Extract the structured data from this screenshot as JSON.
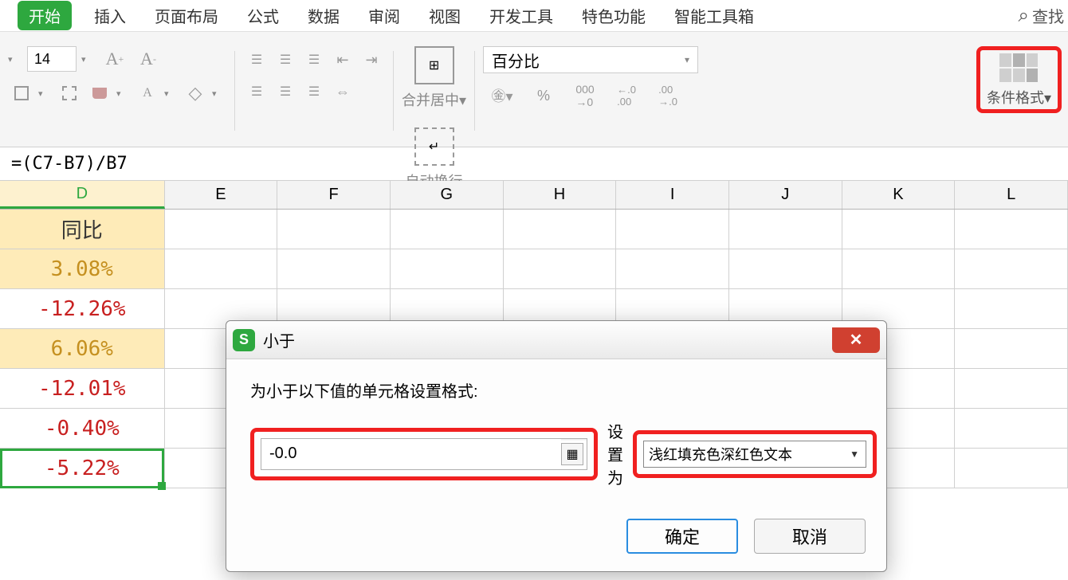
{
  "menu": {
    "items": [
      "开始",
      "插入",
      "页面布局",
      "公式",
      "数据",
      "审阅",
      "视图",
      "开发工具",
      "特色功能",
      "智能工具箱"
    ],
    "active_index": 0,
    "search_label": "查找"
  },
  "ribbon": {
    "font_size": "14",
    "merge_label": "合并居中",
    "wrap_label": "自动换行",
    "number_format": "百分比",
    "cond_fmt_label": "条件格式"
  },
  "formula": "=(C7-B7)/B7",
  "grid": {
    "columns": [
      "D",
      "E",
      "F",
      "G",
      "H",
      "I",
      "J",
      "K",
      "L"
    ],
    "selected_col_index": 0,
    "d_cells": [
      {
        "v": "同比",
        "cls": "header-cell"
      },
      {
        "v": "3.08%",
        "cls": "pos"
      },
      {
        "v": "-12.26%",
        "cls": "neg"
      },
      {
        "v": "6.06%",
        "cls": "pos"
      },
      {
        "v": "-12.01%",
        "cls": "neg"
      },
      {
        "v": "-0.40%",
        "cls": "neg"
      },
      {
        "v": "-5.22%",
        "cls": "neg active"
      }
    ]
  },
  "dialog": {
    "title": "小于",
    "prompt": "为小于以下值的单元格设置格式:",
    "input_value": "-0.0",
    "set_label": "设置为",
    "select_value": "浅红填充色深红色文本",
    "ok": "确定",
    "cancel": "取消"
  }
}
